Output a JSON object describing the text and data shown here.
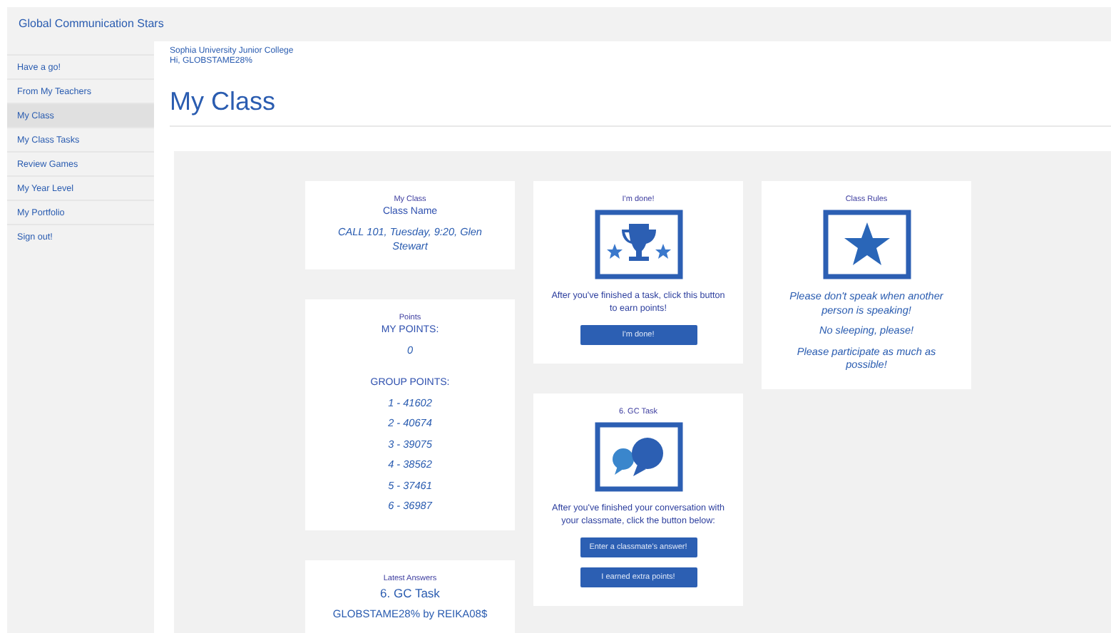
{
  "brand": "Global Communication Stars",
  "sidebar": {
    "items": [
      {
        "label": "Have a go!",
        "selected": false
      },
      {
        "label": "From My Teachers",
        "selected": false
      },
      {
        "label": "My Class",
        "selected": true
      },
      {
        "label": "My Class Tasks",
        "selected": false
      },
      {
        "label": "Review Games",
        "selected": false
      },
      {
        "label": "My Year Level",
        "selected": false
      },
      {
        "label": "My Portfolio",
        "selected": false
      },
      {
        "label": "Sign out!",
        "selected": false
      }
    ]
  },
  "header": {
    "school": "Sophia University Junior College",
    "greeting": "Hi, GLOBSTAME28%",
    "title": "My Class"
  },
  "columns": [
    [
      {
        "lines": [
          {
            "kind": "label",
            "text": "My Class"
          },
          {
            "kind": "heading",
            "text": "Class Name"
          },
          {
            "kind": "italic",
            "text": "CALL 101, Tuesday, 9:20, Glen Stewart"
          }
        ]
      },
      {
        "lines": [
          {
            "kind": "label",
            "text": "Points"
          },
          {
            "kind": "heading",
            "text": "MY POINTS:"
          },
          {
            "kind": "italic",
            "text": "0"
          },
          {
            "kind": "gap"
          },
          {
            "kind": "heading",
            "text": "GROUP POINTS:"
          },
          {
            "kind": "italic",
            "text": "1 - 41602"
          },
          {
            "kind": "italic",
            "text": "2 - 40674"
          },
          {
            "kind": "italic",
            "text": "3 - 39075"
          },
          {
            "kind": "italic",
            "text": "4 - 38562"
          },
          {
            "kind": "italic",
            "text": "5 - 37461"
          },
          {
            "kind": "italic",
            "text": "6 - 36987"
          }
        ]
      },
      {
        "lines": [
          {
            "kind": "label",
            "text": "Latest Answers"
          },
          {
            "kind": "title",
            "text": "6. GC Task"
          },
          {
            "kind": "plain",
            "text": "GLOBSTAME28% by REIKA08$"
          }
        ]
      }
    ],
    [
      {
        "lines": [
          {
            "kind": "label",
            "text": "I'm done!"
          },
          {
            "kind": "icon"
          },
          {
            "kind": "text",
            "text": "After you've finished a task, click this button to earn points!"
          },
          {
            "kind": "button",
            "text": "I'm done!"
          }
        ]
      },
      {
        "lines": [
          {
            "kind": "label",
            "text": "6. GC Task"
          },
          {
            "kind": "icon"
          },
          {
            "kind": "text",
            "text": "After you've finished your conversation with your classmate, click the button below:"
          },
          {
            "kind": "button",
            "text": "Enter a classmate's answer!"
          },
          {
            "kind": "button",
            "text": "I earned extra points!"
          }
        ]
      }
    ],
    [
      {
        "lines": [
          {
            "kind": "label",
            "text": "Class Rules"
          },
          {
            "kind": "icon"
          },
          {
            "kind": "italic",
            "text": "Please don't speak when another person is speaking!"
          },
          {
            "kind": "italic",
            "text": "No sleeping, please!"
          },
          {
            "kind": "italic",
            "text": "Please participate as much as possible!"
          }
        ]
      }
    ]
  ]
}
